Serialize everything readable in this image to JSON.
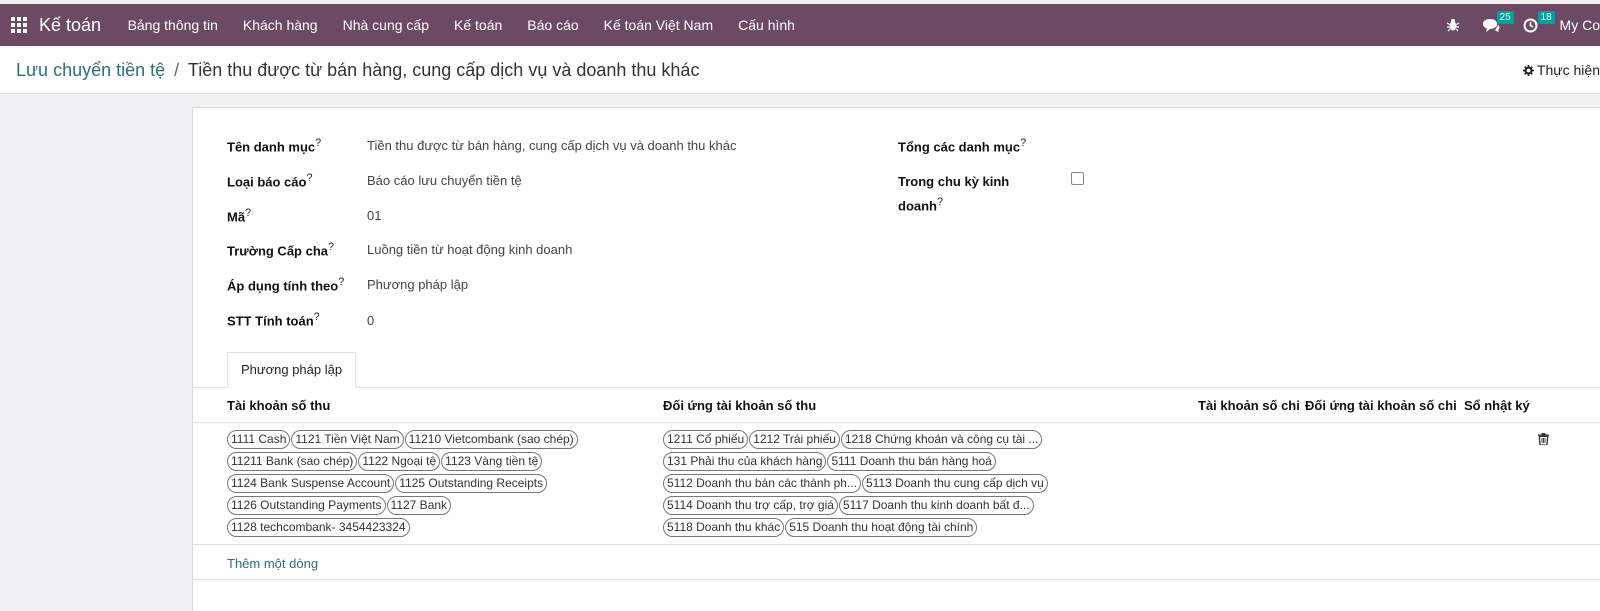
{
  "navbar": {
    "brand": "Kế toán",
    "menu": [
      "Bảng thông tin",
      "Khách hàng",
      "Nhà cung cấp",
      "Kế toán",
      "Báo cáo",
      "Kế toán Việt Nam",
      "Cấu hình"
    ],
    "messages_count": "25",
    "activities_count": "18",
    "company": "My Co",
    "color": "#6d4a63"
  },
  "breadcrumb": {
    "parent": "Lưu chuyển tiền tệ",
    "separator": "/",
    "current": "Tiền thu được từ bán hàng, cung cấp dịch vụ và doanh thu khác"
  },
  "action_label": "Thực hiện",
  "help_mark": "?",
  "form": {
    "name_label": "Tên danh mục",
    "name_value": "Tiền thu được từ bán hàng, cung cấp dịch vụ và doanh thu khác",
    "report_type_label": "Loại báo cáo",
    "report_type_value": "Báo cáo lưu chuyển tiền tệ",
    "code_label": "Mã",
    "code_value": "01",
    "parent_label": "Trường Cấp cha",
    "parent_value": "Luồng tiền từ hoạt động kinh doanh",
    "apply_label": "Áp dụng tính theo",
    "apply_value": "Phương pháp lập",
    "seq_label": "STT Tính toán",
    "seq_value": "0",
    "total_label": "Tổng các danh mục",
    "cycle_label_1": "Trong chu kỳ kinh",
    "cycle_label_2": "doanh"
  },
  "tab_label": "Phương pháp lập",
  "table": {
    "headers": [
      "Tài khoản số thu",
      "Đối ứng tài khoản số thu",
      "Tài khoản số chi",
      "Đối ứng tài khoản số chi",
      "Sổ nhật ký"
    ],
    "receipt_accounts": [
      "1111 Cash",
      "1121 Tiền Việt Nam",
      "11210 Vietcombank (sao chép)",
      "11211 Bank (sao chép)",
      "1122 Ngoại tệ",
      "1123 Vàng tiền tệ",
      "1124 Bank Suspense Account",
      "1125 Outstanding Receipts",
      "1126 Outstanding Payments",
      "1127 Bank",
      "1128 techcombank- 3454423324"
    ],
    "counter_accounts": [
      "1211 Cổ phiếu",
      "1212 Trái phiếu",
      "1218 Chứng khoán và công cụ tài ...",
      "131 Phải thu của khách hàng",
      "5111 Doanh thu bán hàng hoá",
      "5112 Doanh thu bán các thành ph...",
      "5113 Doanh thu cung cấp dịch vụ",
      "5114 Doanh thu trợ cấp, trợ giá",
      "5117 Doanh thu kinh doanh bất đ...",
      "5118 Doanh thu khác",
      "515 Doanh thu hoạt động tài chính"
    ],
    "add_line": "Thêm một dòng"
  }
}
